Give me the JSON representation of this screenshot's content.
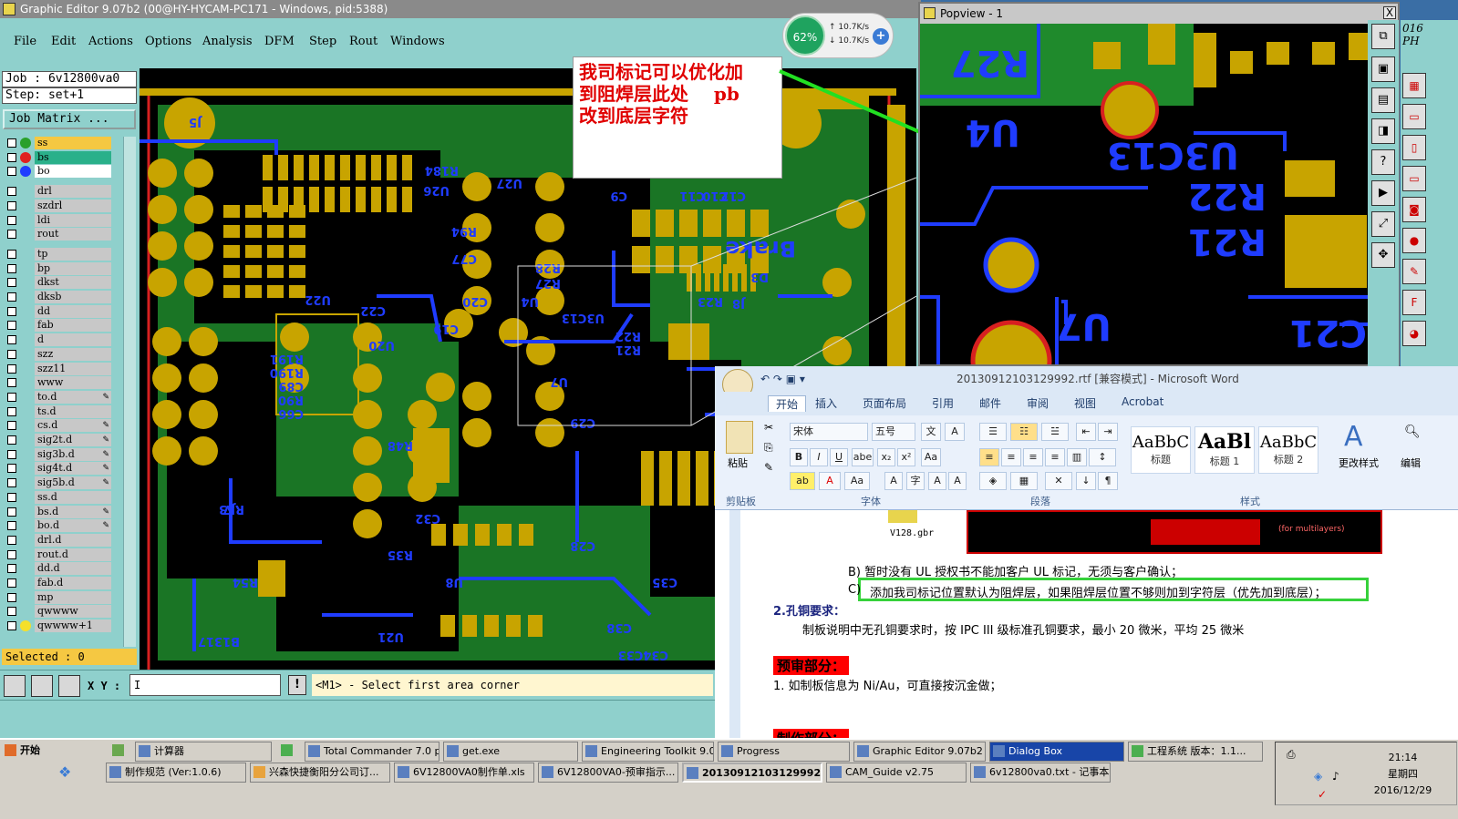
{
  "ge": {
    "title": "Graphic Editor 9.07b2 (00@HY-HYCAM-PC171 - Windows, pid:5388)",
    "menu": [
      "File",
      "Edit",
      "Actions",
      "Options",
      "Analysis",
      "DFM",
      "Step",
      "Rout",
      "Windows"
    ],
    "job": "Job : 6v12800va0",
    "step": "Step: set+1",
    "job_matrix": "Job Matrix ...",
    "layers": [
      "ss",
      "bs",
      "bo",
      "drl",
      "szdrl",
      "ldi",
      "rout",
      "tp",
      "bp",
      "dkst",
      "dksb",
      "dd",
      "fab",
      "d",
      "szz",
      "szz11",
      "www",
      "to.d",
      "ts.d",
      "cs.d",
      "sig2t.d",
      "sig3b.d",
      "sig4t.d",
      "sig5b.d",
      "ss.d",
      "bs.d",
      "bo.d",
      "drl.d",
      "rout.d",
      "dd.d",
      "fab.d",
      "mp",
      "qwwww",
      "qwwww+1"
    ],
    "selected": "Selected : 0",
    "xy_label": "X Y :",
    "xy_value": "I",
    "warn": "!",
    "status": "<M1> - Select first area corner",
    "canvas_labels": [
      "J5",
      "U27",
      "U26",
      "R94",
      "C77",
      "R184",
      "C10",
      "C12",
      "C11",
      "C9",
      "Brake",
      "R27",
      "R28",
      "U4",
      "J8",
      "R23",
      "C20",
      "C19",
      "U3C13",
      "R22",
      "R21",
      "U22",
      "C22",
      "U20",
      "R191",
      "R190",
      "C89",
      "R90",
      "C66",
      "U7",
      "C29",
      "R48",
      "R53",
      "C32",
      "R35",
      "U8",
      "U21",
      "C35",
      "C34C33",
      "C38",
      "C28",
      "D3",
      "J7",
      "B1317",
      "R54"
    ]
  },
  "annotation": {
    "lines": [
      "我司标记可以优化加",
      "到阻焊层此处    pb",
      "改到底层字符"
    ]
  },
  "net": {
    "percent": "62%",
    "up": "10.7K/s",
    "down": "10.7K/s",
    "plus": "+"
  },
  "popview": {
    "title": "Popview - 1",
    "close": "X",
    "labels": [
      "R27",
      "U4",
      "U3C13",
      "R22",
      "R21",
      "U7",
      "C21"
    ],
    "top_right": [
      "016",
      "PH"
    ]
  },
  "word": {
    "title": "20130912103129992.rtf [兼容模式] - Microsoft Word",
    "tabs": [
      "开始",
      "插入",
      "页面布局",
      "引用",
      "邮件",
      "审阅",
      "视图",
      "Acrobat"
    ],
    "font_name": "宋体",
    "font_size": "五号",
    "paste": "粘贴",
    "groups": [
      "剪贴板",
      "字体",
      "段落",
      "样式"
    ],
    "styles": [
      {
        "preview": "AaBbC",
        "name": "标题"
      },
      {
        "preview": "AaBl",
        "name": "标题 1"
      },
      {
        "preview": "AaBbC",
        "name": "标题 2"
      }
    ],
    "change_styles": "更改样式",
    "edit": "编辑",
    "doc": {
      "img_caption": "V128.gbr",
      "img_note": "(for multilayers)",
      "line_b": "B)  暂时没有 UL 授权书不能加客户 UL 标记，无须与客户确认；",
      "line_c_prefix": "C)",
      "line_c": "添加我司标记位置默认为阻焊层，如果阻焊层位置不够则加到字符层（优先加到底层）；",
      "section2": "2.孔铜要求：",
      "line_2": "制板说明中无孔铜要求时，按 IPC III 级标准孔铜要求，最小 20 微米，平均 25 微米",
      "pre_review": "预审部分：",
      "item1": "1.   如制板信息为 Ni/Au，可直接按沉金做；",
      "pre_review2": "制作部分："
    }
  },
  "taskbar": {
    "start": "开始",
    "row1": [
      "计算器",
      "Total Commander 7.0 p...",
      "get.exe",
      "Engineering Toolkit 9.0...",
      "Progress",
      "Graphic Editor 9.07b2 (...",
      "Dialog Box",
      "工程系统  版本：1.1..."
    ],
    "row2": [
      "制作规范 (Ver:1.0.6)",
      "兴森快捷衡阳分公司订...",
      "6V12800VA0制作单.xls",
      "6V12800VA0-预审指示...",
      "20130912103129992....",
      "CAM_Guide v2.75",
      "6v12800va0.txt - 记事本"
    ],
    "time": "21:14",
    "weekday": "星期四",
    "date": "2016/12/29"
  }
}
